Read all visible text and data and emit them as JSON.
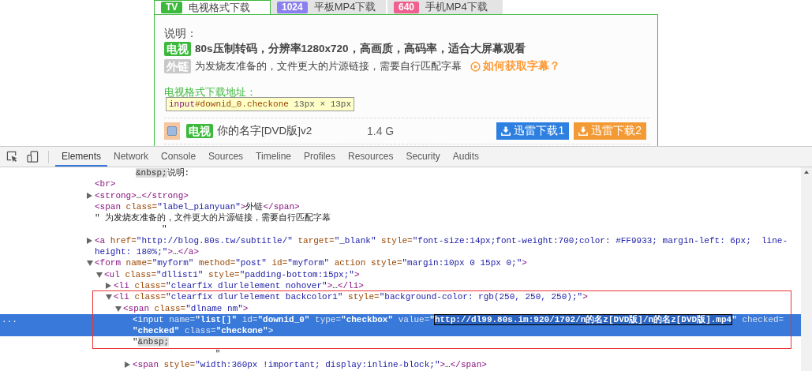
{
  "page": {
    "tabs": [
      {
        "badge": "TV",
        "label": "电视格式下载",
        "color": "#3cb93c",
        "selected": true
      },
      {
        "badge": "1024",
        "label": "平板MP4下载",
        "color": "#8b80f0",
        "selected": false
      },
      {
        "badge": "640",
        "label": "手机MP4下载",
        "color": "#f0608f",
        "selected": false
      }
    ],
    "note_title": "说明：",
    "notes": [
      {
        "kind": "tv",
        "badge": "电视",
        "text": "80s压制转码，分辨率1280x720，高画质，高码率，适合大屏幕观看"
      },
      {
        "kind": "external",
        "badge": "外链",
        "text": "为发烧友准备的，文件更大的片源链接，需要自行匹配字幕",
        "link": "如何获取字幕？"
      }
    ],
    "section_title": "电视格式下载地址：",
    "inspect_tooltip": {
      "tag": "input",
      "selector": "#downid_0.checkone",
      "size": "13px × 13px"
    },
    "files": [
      {
        "checked": false,
        "badge": "电视",
        "name": "你的名字[DVD版]v2",
        "size": "1.4 G",
        "buttons": [
          {
            "kind": "primary",
            "label": "迅雷下载1"
          },
          {
            "kind": "secondary",
            "label": "迅雷下载2"
          }
        ]
      }
    ]
  },
  "devtools": {
    "tabs": [
      {
        "label": "Elements",
        "selected": true
      },
      {
        "label": "Network",
        "selected": false
      },
      {
        "label": "Console",
        "selected": false
      },
      {
        "label": "Sources",
        "selected": false
      },
      {
        "label": "Timeline",
        "selected": false
      },
      {
        "label": "Profiles",
        "selected": false
      },
      {
        "label": "Resources",
        "selected": false
      },
      {
        "label": "Security",
        "selected": false
      },
      {
        "label": "Audits",
        "selected": false
      }
    ],
    "gutter_mark": "...",
    "dom": [
      {
        "selected": false,
        "lines": [
          {
            "kind": "continuation",
            "tokens": [
              {
                "kind": "nbsp",
                "text": "&nbsp;"
              },
              {
                "kind": "text",
                "text": "说明:"
              }
            ]
          }
        ]
      },
      {
        "selected": false,
        "lines": [
          {
            "tokens": [
              {
                "kind": "tag",
                "text": "<br>"
              }
            ]
          }
        ]
      },
      {
        "selected": false,
        "expanded": false,
        "lines": [
          {
            "tokens": [
              {
                "kind": "tag",
                "text": "<strong>"
              },
              {
                "kind": "text",
                "text": "…"
              },
              {
                "kind": "tag",
                "text": "</strong>"
              }
            ]
          }
        ]
      },
      {
        "selected": false,
        "lines": [
          {
            "tokens": [
              {
                "kind": "tag",
                "text": "<span"
              },
              {
                "kind": "attr",
                "text": " class="
              },
              {
                "kind": "val",
                "text": "\"label_pianyuan\""
              },
              {
                "kind": "tag",
                "text": ">"
              },
              {
                "kind": "text",
                "text": "外链"
              },
              {
                "kind": "tag",
                "text": "</span>"
              }
            ]
          }
        ]
      },
      {
        "selected": false,
        "lines": [
          {
            "tokens": [
              {
                "kind": "text",
                "text": "\" 为发烧友准备的，文件更大的片源链接，需要自行匹配字幕"
              }
            ]
          },
          {
            "kind": "continuation",
            "tokens": [
              {
                "kind": "text",
                "text": "     \""
              }
            ]
          }
        ]
      },
      {
        "selected": false,
        "expanded": false,
        "lines": [
          {
            "tokens": [
              {
                "kind": "tag",
                "text": "<a"
              },
              {
                "kind": "attr",
                "text": " href="
              },
              {
                "kind": "val",
                "text": "\"http://blog.80s.tw/subtitle/\""
              },
              {
                "kind": "attr",
                "text": " target="
              },
              {
                "kind": "val",
                "text": "\"_blank\""
              },
              {
                "kind": "attr",
                "text": " style="
              },
              {
                "kind": "val",
                "text": "\"font-size:14px;font-weight:700;color: #FF9933; margin-left: 6px;  line-"
              }
            ]
          },
          {
            "tokens": [
              {
                "kind": "val",
                "text": "height: 180%;\""
              },
              {
                "kind": "tag",
                "text": ">"
              },
              {
                "kind": "text",
                "text": "…"
              },
              {
                "kind": "tag",
                "text": "</a>"
              }
            ]
          }
        ]
      },
      {
        "selected": false,
        "expanded": true,
        "lines": [
          {
            "tokens": [
              {
                "kind": "tag",
                "text": "<form"
              },
              {
                "kind": "attr",
                "text": " name="
              },
              {
                "kind": "val",
                "text": "\"myform\""
              },
              {
                "kind": "attr",
                "text": " method="
              },
              {
                "kind": "val",
                "text": "\"post\""
              },
              {
                "kind": "attr",
                "text": " id="
              },
              {
                "kind": "val",
                "text": "\"myform\""
              },
              {
                "kind": "attr",
                "text": " action style="
              },
              {
                "kind": "val",
                "text": "\"margin:10px 0 15px 0;\""
              },
              {
                "kind": "tag",
                "text": ">"
              }
            ]
          }
        ],
        "children": [
          {
            "selected": false,
            "expanded": true,
            "lines": [
              {
                "tokens": [
                  {
                    "kind": "tag",
                    "text": "<ul"
                  },
                  {
                    "kind": "attr",
                    "text": " class="
                  },
                  {
                    "kind": "val",
                    "text": "\"dllist1\""
                  },
                  {
                    "kind": "attr",
                    "text": " style="
                  },
                  {
                    "kind": "val",
                    "text": "\"padding-bottom:15px;\""
                  },
                  {
                    "kind": "tag",
                    "text": ">"
                  }
                ]
              }
            ],
            "children": [
              {
                "selected": false,
                "expanded": false,
                "lines": [
                  {
                    "tokens": [
                      {
                        "kind": "tag",
                        "text": "<li"
                      },
                      {
                        "kind": "attr",
                        "text": " class="
                      },
                      {
                        "kind": "val",
                        "text": "\"clearfix dlurlelement nohover\""
                      },
                      {
                        "kind": "tag",
                        "text": ">"
                      },
                      {
                        "kind": "text",
                        "text": "…"
                      },
                      {
                        "kind": "tag",
                        "text": "</li>"
                      }
                    ]
                  }
                ]
              },
              {
                "selected": false,
                "expanded": true,
                "lines": [
                  {
                    "tokens": [
                      {
                        "kind": "tag",
                        "text": "<li"
                      },
                      {
                        "kind": "attr",
                        "text": " class="
                      },
                      {
                        "kind": "val",
                        "text": "\"clearfix dlurlelement backcolor1\""
                      },
                      {
                        "kind": "attr",
                        "text": " style="
                      },
                      {
                        "kind": "val",
                        "text": "\"background-color: rgb(250, 250, 250);\""
                      },
                      {
                        "kind": "tag",
                        "text": ">"
                      }
                    ]
                  }
                ],
                "children": [
                  {
                    "selected": false,
                    "expanded": true,
                    "lines": [
                      {
                        "tokens": [
                          {
                            "kind": "tag",
                            "text": "<span"
                          },
                          {
                            "kind": "attr",
                            "text": " class="
                          },
                          {
                            "kind": "val",
                            "text": "\"dlname nm\""
                          },
                          {
                            "kind": "tag",
                            "text": ">"
                          }
                        ]
                      }
                    ],
                    "children": [
                      {
                        "selected": true,
                        "lines": [
                          {
                            "tokens": [
                              {
                                "kind": "tag",
                                "text": "<input"
                              },
                              {
                                "kind": "attr",
                                "text": " name="
                              },
                              {
                                "kind": "val",
                                "text": "\"list[]\""
                              },
                              {
                                "kind": "attr",
                                "text": " id="
                              },
                              {
                                "kind": "val",
                                "text": "\"downid_0\""
                              },
                              {
                                "kind": "attr",
                                "text": " type="
                              },
                              {
                                "kind": "val",
                                "text": "\"checkbox\""
                              },
                              {
                                "kind": "attr",
                                "text": " value="
                              },
                              {
                                "kind": "val",
                                "text": "\""
                              },
                              {
                                "kind": "match",
                                "text": "http://dl99.80s.im:920/1702/n的名z[DVD版]/n的名z[DVD版].mp4"
                              },
                              {
                                "kind": "val",
                                "text": "\""
                              },
                              {
                                "kind": "attr",
                                "text": " checked="
                              }
                            ]
                          },
                          {
                            "tokens": [
                              {
                                "kind": "val",
                                "text": "\"checked\""
                              },
                              {
                                "kind": "attr",
                                "text": " class="
                              },
                              {
                                "kind": "val",
                                "text": "\"checkone\""
                              },
                              {
                                "kind": "tag",
                                "text": ">"
                              }
                            ]
                          }
                        ]
                      },
                      {
                        "selected": false,
                        "lines": [
                          {
                            "tokens": [
                              {
                                "kind": "text",
                                "text": "\""
                              },
                              {
                                "kind": "nbsp",
                                "text": "&nbsp;"
                              }
                            ]
                          },
                          {
                            "kind": "continuation",
                            "tokens": [
                              {
                                "kind": "text",
                                "text": "        \""
                              }
                            ]
                          }
                        ]
                      },
                      {
                        "selected": false,
                        "expanded": false,
                        "lines": [
                          {
                            "tokens": [
                              {
                                "kind": "tag",
                                "text": "<span"
                              },
                              {
                                "kind": "attr",
                                "text": " style="
                              },
                              {
                                "kind": "val",
                                "text": "\"width:360px !important; display:inline-block;\""
                              },
                              {
                                "kind": "tag",
                                "text": ">"
                              },
                              {
                                "kind": "text",
                                "text": "…"
                              },
                              {
                                "kind": "tag",
                                "text": "</span>"
                              }
                            ]
                          }
                        ]
                      }
                    ]
                  }
                ]
              }
            ]
          }
        ]
      }
    ]
  }
}
